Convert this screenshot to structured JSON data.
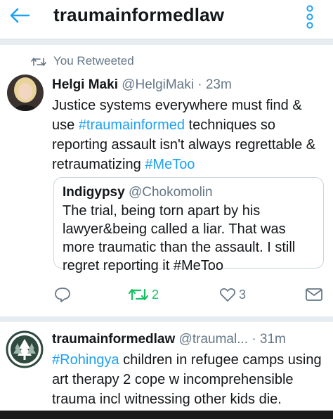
{
  "header": {
    "title": "traumainformedlaw",
    "accent": "#1da1f2"
  },
  "tweet1": {
    "retweet_context": "You Retweeted",
    "author_name": "Helgi Maki",
    "author_handle": "@HelgiMaki",
    "separator": "·",
    "time": "23m",
    "text_part1": "Justice systems everywhere must find & use ",
    "hashtag1": "#traumainformed",
    "text_part2": " techniques so reporting assault isn't always regrettable & retraumatizing ",
    "hashtag2": "#MeToo",
    "quote": {
      "author_name": "Indigypsy",
      "author_handle": "@Chokomolin",
      "text": "The trial, being torn apart by his lawyer&being called a liar. That was more traumatic than the assault. I still regret reporting it #MeToo"
    },
    "actions": {
      "retweet_count": "2",
      "like_count": "3"
    },
    "colors": {
      "retweet_active": "#17bf63",
      "icon_grey": "#657786"
    }
  },
  "tweet2": {
    "author_name": "traumainformedlaw",
    "author_handle": "@traumal...",
    "separator": "·",
    "time": "31m",
    "hashtag1": "#Rohingya",
    "text": " children in refugee camps using art therapy 2 cope w incomprehensible trauma incl witnessing other kids die. Beyond heartbreaking"
  }
}
